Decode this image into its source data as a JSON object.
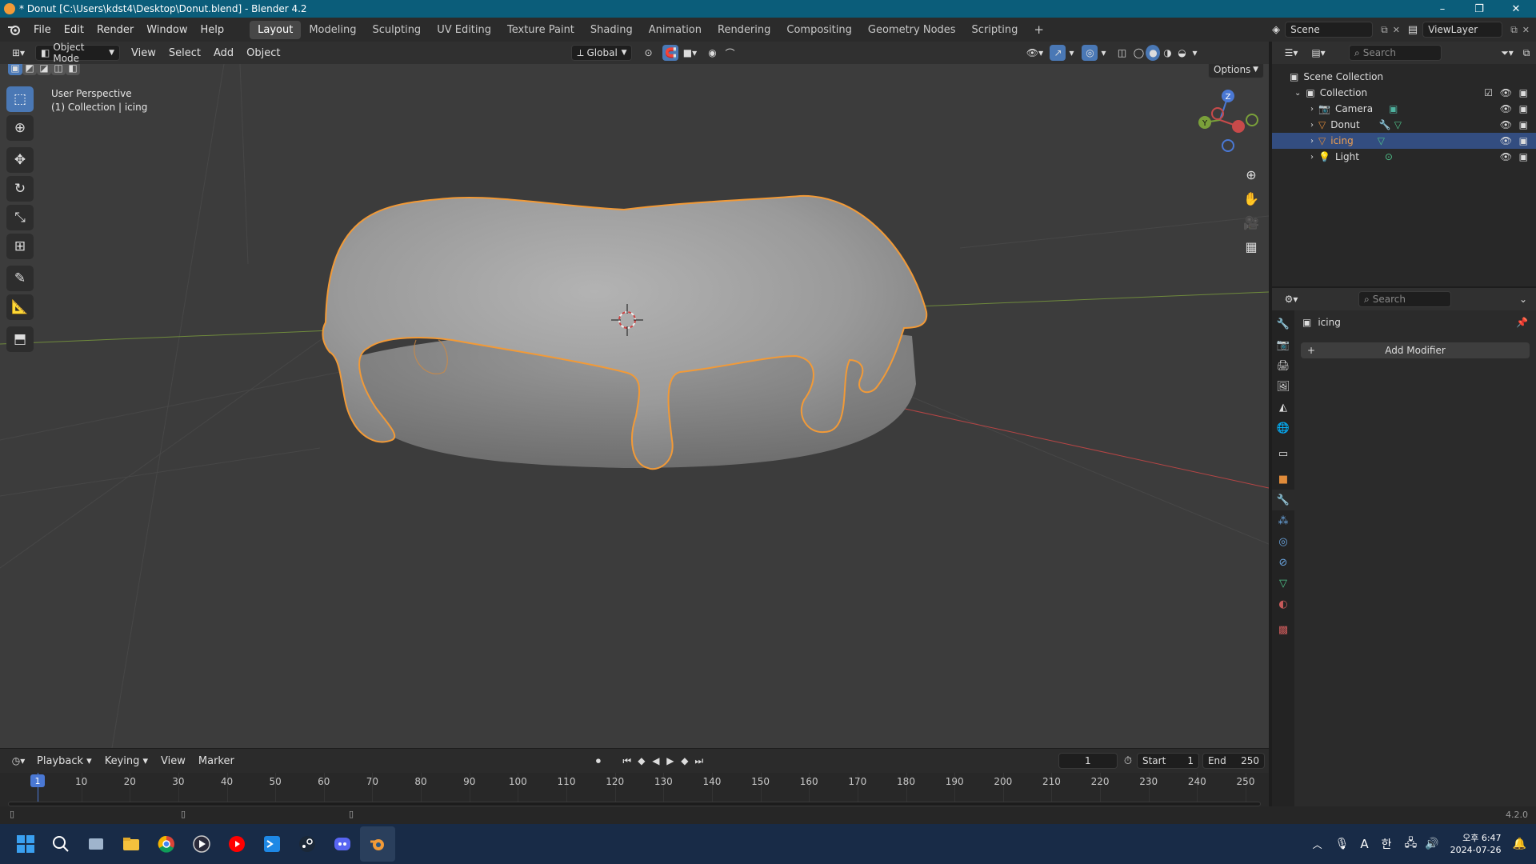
{
  "window": {
    "title": "* Donut [C:\\Users\\kdst4\\Desktop\\Donut.blend] - Blender 4.2",
    "minimize": "–",
    "maximize": "❐",
    "close": "✕"
  },
  "menubar": {
    "items": [
      "File",
      "Edit",
      "Render",
      "Window",
      "Help"
    ],
    "workspaces": [
      "Layout",
      "Modeling",
      "Sculpting",
      "UV Editing",
      "Texture Paint",
      "Shading",
      "Animation",
      "Rendering",
      "Compositing",
      "Geometry Nodes",
      "Scripting"
    ],
    "active_workspace": "Layout",
    "add_workspace": "+",
    "scene_label": "Scene",
    "view_layer_label": "ViewLayer"
  },
  "viewport_header": {
    "mode": "Object Mode",
    "menus": [
      "View",
      "Select",
      "Add",
      "Object"
    ],
    "transform_orientation": "Global",
    "options": "Options"
  },
  "viewport": {
    "perspective_label": "User Perspective",
    "collection_label": "(1) Collection | icing",
    "gizmo_axes": {
      "z": "Z",
      "y": "Y",
      "x": "X"
    },
    "colors": {
      "background": "#3c3c3c",
      "selection_outline": "#f29a37",
      "x_axis": "#c84a4a",
      "y_axis": "#7a9a3a"
    }
  },
  "tools": [
    "select-box-icon",
    "cursor-icon",
    "move-icon",
    "rotate-icon",
    "scale-icon",
    "transform-icon",
    "annotate-icon",
    "measure-icon",
    "add-cube-icon"
  ],
  "outliner": {
    "search_placeholder": "Search",
    "root": "Scene Collection",
    "collection": "Collection",
    "items": [
      {
        "name": "Camera",
        "icon": "camera-icon",
        "selected": false
      },
      {
        "name": "Donut",
        "icon": "mesh-icon",
        "selected": false
      },
      {
        "name": "icing",
        "icon": "mesh-icon",
        "selected": true
      },
      {
        "name": "Light",
        "icon": "light-icon",
        "selected": false
      }
    ]
  },
  "properties": {
    "search_placeholder": "Search",
    "object_name": "icing",
    "add_modifier": "Add Modifier"
  },
  "timeline": {
    "menus": [
      "Playback",
      "Keying",
      "View",
      "Marker"
    ],
    "current_frame": "1",
    "start_label": "Start",
    "start": "1",
    "end_label": "End",
    "end": "250",
    "ticks": [
      "1",
      "10",
      "20",
      "30",
      "40",
      "50",
      "60",
      "70",
      "80",
      "90",
      "100",
      "110",
      "120",
      "130",
      "140",
      "150",
      "160",
      "170",
      "180",
      "190",
      "200",
      "210",
      "220",
      "230",
      "240",
      "250"
    ]
  },
  "statusbar": {
    "version": "4.2.0"
  },
  "taskbar": {
    "apps": [
      "windows-start-icon",
      "search-icon",
      "task-view-icon",
      "file-explorer-icon",
      "chrome-icon",
      "media-player-icon",
      "youtube-music-icon",
      "vscode-icon",
      "steam-icon",
      "discord-icon",
      "blender-icon"
    ],
    "ime": "A",
    "korean_ime": "한",
    "time": "오후 6:47",
    "date": "2024-07-26"
  }
}
